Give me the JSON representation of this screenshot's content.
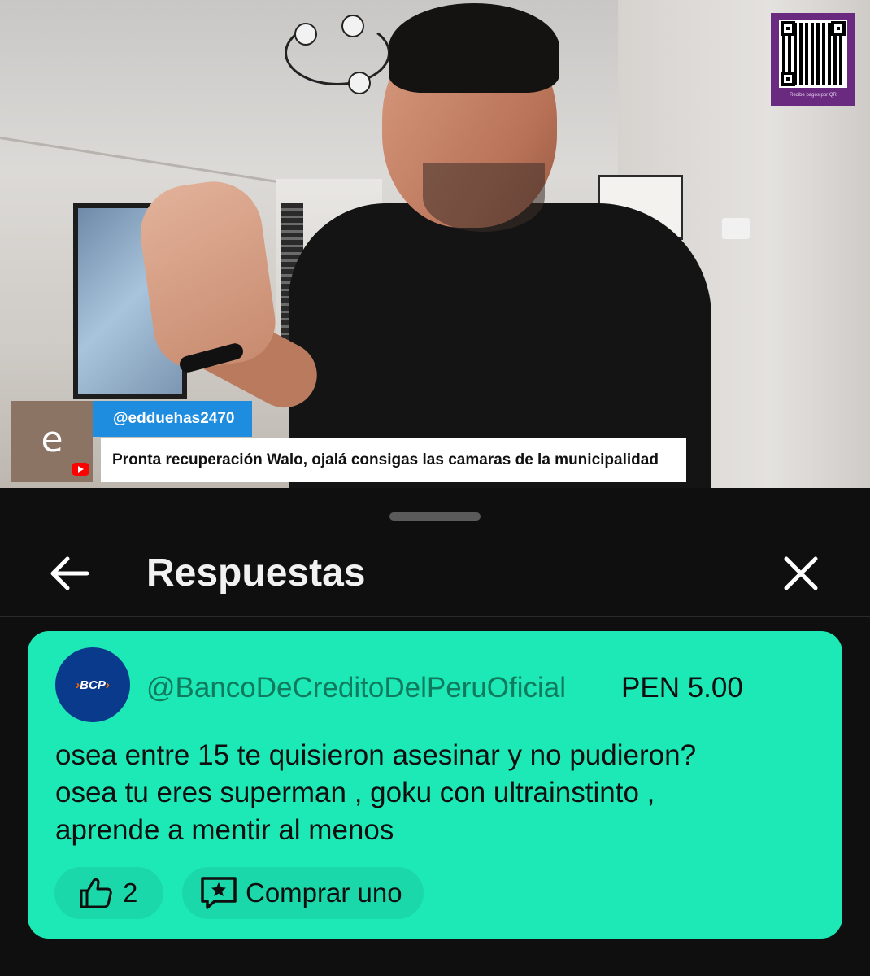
{
  "video": {
    "qr": {
      "caption": "Recibe pagos por QR"
    },
    "chat_overlay": {
      "avatar_letter": "e",
      "username": "@edduehas2470",
      "message": "Pronta recuperación Walo, ojalá consigas las camaras de la municipalidad"
    }
  },
  "sheet": {
    "title": "Respuestas",
    "back_icon": "arrow-left-icon",
    "close_icon": "close-icon",
    "super_chat": {
      "avatar_logo": "BCP",
      "username": "@BancoDeCreditoDelPeruOficial",
      "amount": "PEN 5.00",
      "message_lines": [
        "osea entre 15 te quisieron asesinar y no pudieron?",
        "osea tu eres superman , goku con ultrainstinto ,",
        "aprende a mentir al menos"
      ],
      "like_count": "2",
      "buy_label": "Comprar uno",
      "card_color": "#1de9b6"
    }
  }
}
